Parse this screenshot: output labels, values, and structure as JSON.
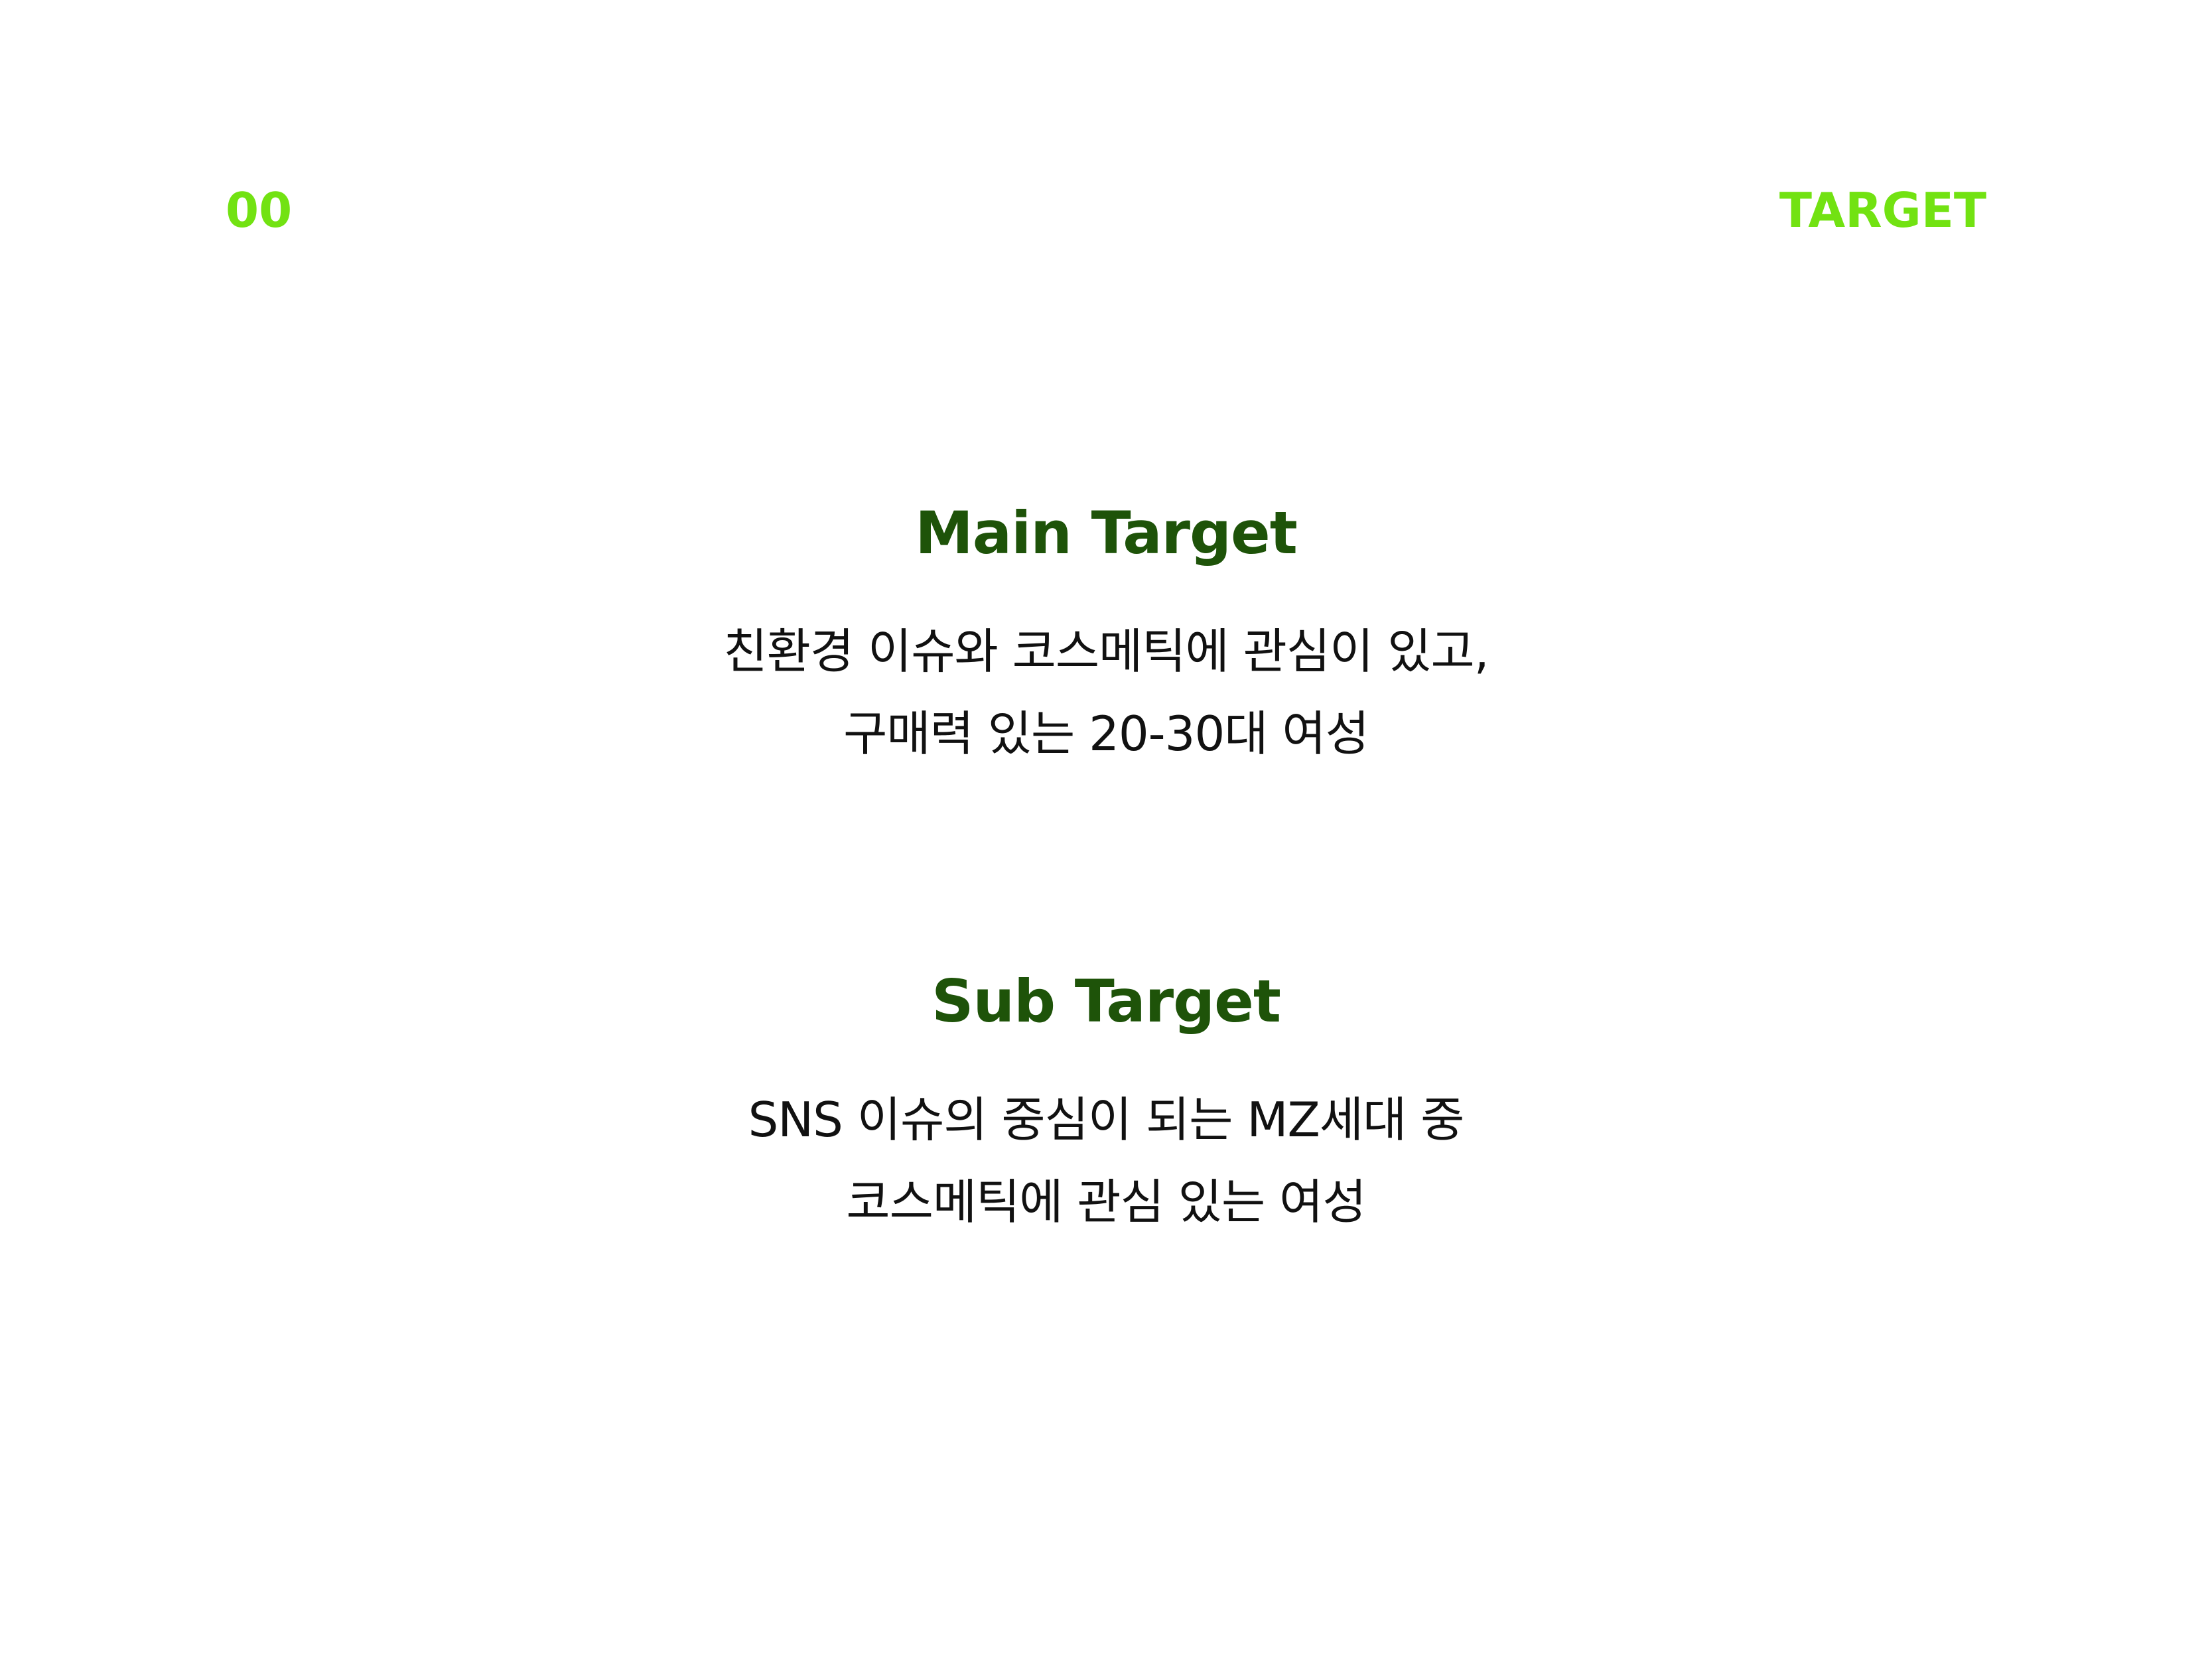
{
  "header": {
    "page_number": "00",
    "section_label": "TARGET"
  },
  "main_target": {
    "title": "Main Target",
    "lines": [
      "친환경 이슈와 코스메틱에 관심이 있고,",
      "구매력 있는 20-30대 여성"
    ]
  },
  "sub_target": {
    "title": "Sub Target",
    "lines": [
      "SNS 이슈의 중심이 되는 MZ세대 중",
      "코스메틱에 관심 있는 여성"
    ]
  },
  "colors": {
    "accent": "#72e212",
    "title": "#1e5309",
    "text": "#111111",
    "background": "#ffffff"
  }
}
